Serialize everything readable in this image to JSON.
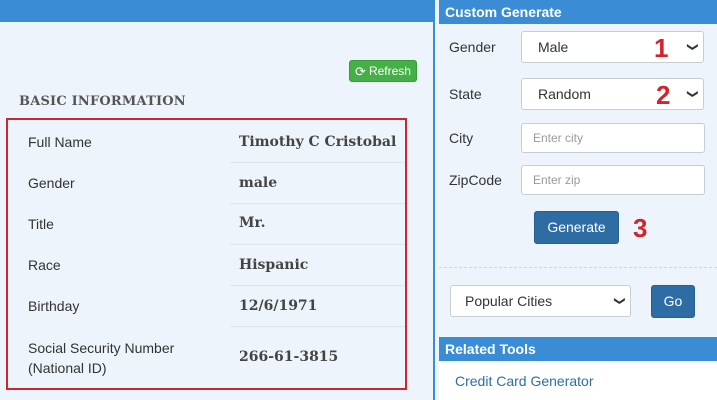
{
  "basic": {
    "refresh_label": "Refresh",
    "refresh_icon": "refresh-icon",
    "section_title": "BASIC INFORMATION",
    "rows": [
      {
        "label": "Full Name",
        "value": "Timothy C Cristobal"
      },
      {
        "label": "Gender",
        "value": "male"
      },
      {
        "label": "Title",
        "value": "Mr."
      },
      {
        "label": "Race",
        "value": "Hispanic"
      },
      {
        "label": "Birthday",
        "value": "12/6/1971"
      },
      {
        "label": "Social Security Number",
        "label2": "(National ID)",
        "value": "266-61-3815"
      }
    ]
  },
  "custom": {
    "title": "Custom Generate",
    "gender_label": "Gender",
    "gender_value": "Male",
    "state_label": "State",
    "state_value": "Random",
    "city_label": "City",
    "city_placeholder": "Enter city",
    "zip_label": "ZipCode",
    "zip_placeholder": "Enter zip",
    "generate_label": "Generate",
    "markers": [
      "1",
      "2",
      "3"
    ],
    "cities_value": "Popular Cities",
    "go_label": "Go"
  },
  "related": {
    "title": "Related Tools",
    "link": "Credit Card Generator"
  },
  "colors": {
    "accent": "#3a8dd4",
    "highlight_border": "#d0252c",
    "button": "#2e6da4",
    "refresh": "#45b045"
  }
}
